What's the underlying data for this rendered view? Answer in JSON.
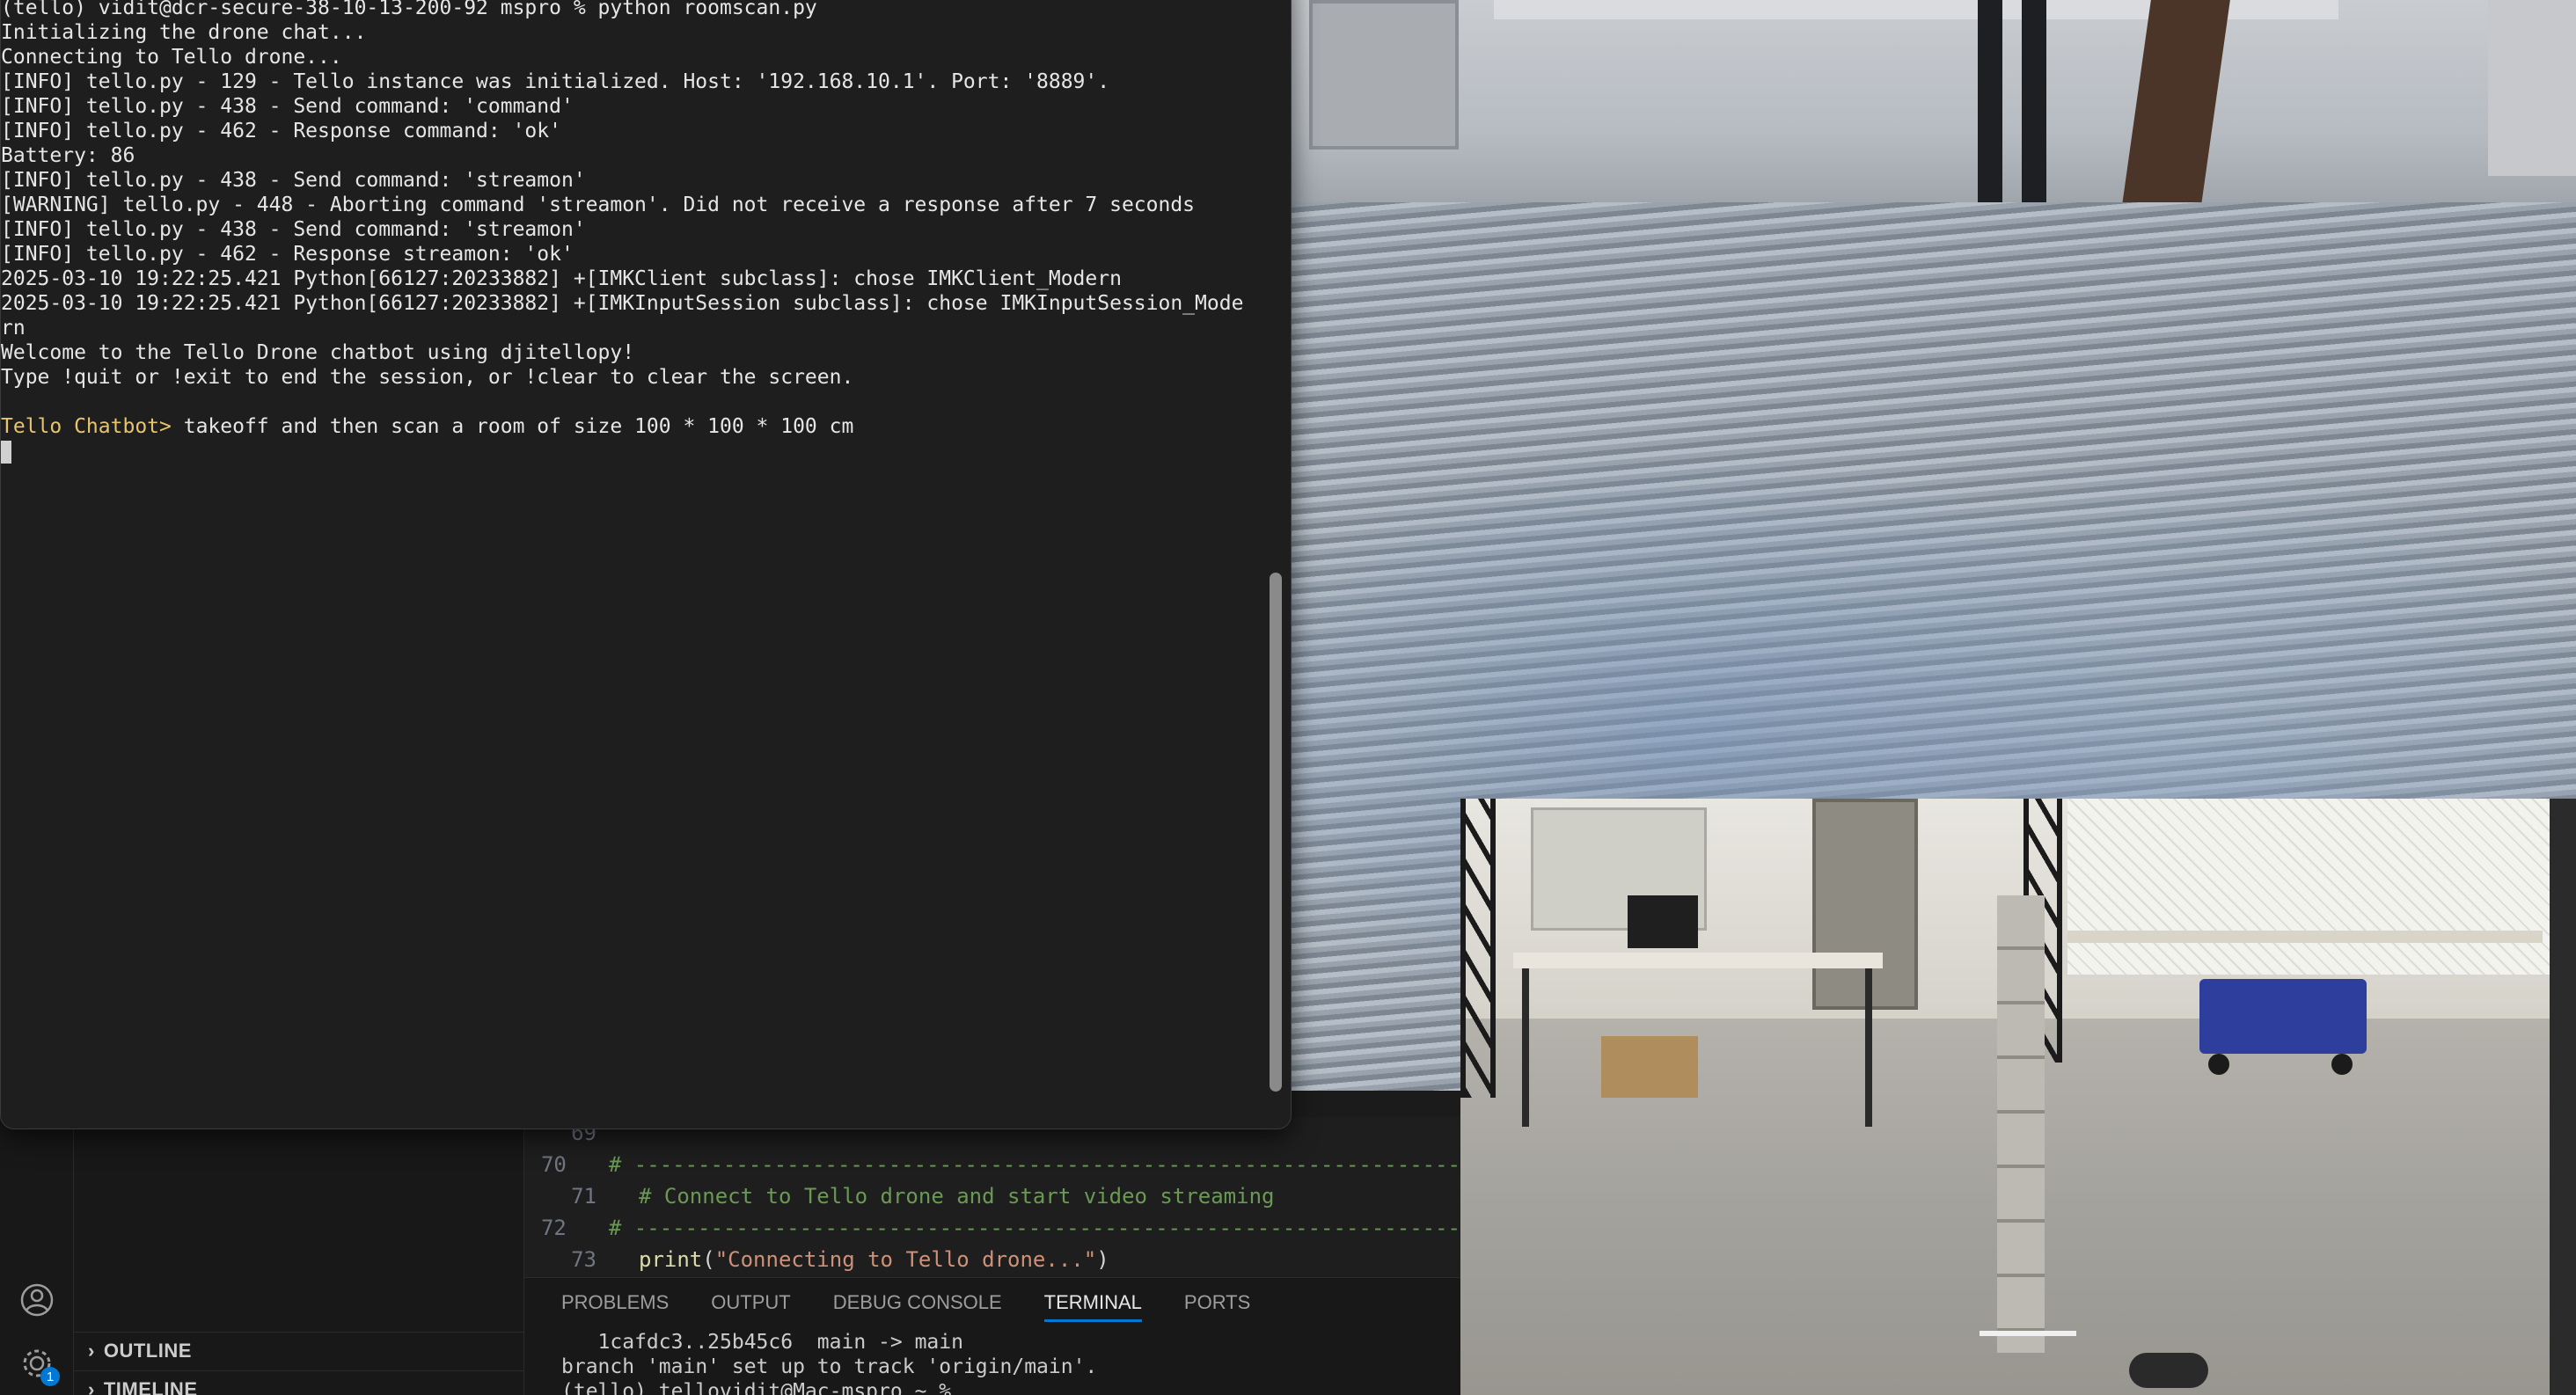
{
  "terminal": {
    "lines": [
      {
        "text": "(tello) vidit@dcr-secure-38-10-13-200-92 mspro % python roomscan.py",
        "kind": "plain"
      },
      {
        "text": "Initializing the drone chat...",
        "kind": "plain"
      },
      {
        "text": "Connecting to Tello drone...",
        "kind": "plain"
      },
      {
        "text": "[INFO] tello.py - 129 - Tello instance was initialized. Host: '192.168.10.1'. Port: '8889'.",
        "kind": "plain"
      },
      {
        "text": "[INFO] tello.py - 438 - Send command: 'command'",
        "kind": "plain"
      },
      {
        "text": "[INFO] tello.py - 462 - Response command: 'ok'",
        "kind": "plain"
      },
      {
        "text": "Battery: 86",
        "kind": "plain"
      },
      {
        "text": "[INFO] tello.py - 438 - Send command: 'streamon'",
        "kind": "plain"
      },
      {
        "text": "[WARNING] tello.py - 448 - Aborting command 'streamon'. Did not receive a response after 7 seconds",
        "kind": "plain"
      },
      {
        "text": "[INFO] tello.py - 438 - Send command: 'streamon'",
        "kind": "plain"
      },
      {
        "text": "[INFO] tello.py - 462 - Response streamon: 'ok'",
        "kind": "plain"
      },
      {
        "text": "2025-03-10 19:22:25.421 Python[66127:20233882] +[IMKClient subclass]: chose IMKClient_Modern",
        "kind": "plain"
      },
      {
        "text": "2025-03-10 19:22:25.421 Python[66127:20233882] +[IMKInputSession subclass]: chose IMKInputSession_Mode",
        "kind": "plain"
      },
      {
        "text": "rn",
        "kind": "plain"
      },
      {
        "text": "Welcome to the Tello Drone chatbot using djitellopy!",
        "kind": "plain"
      },
      {
        "text": "Type !quit or !exit to end the session, or !clear to clear the screen.",
        "kind": "plain"
      },
      {
        "text": "",
        "kind": "plain"
      }
    ],
    "prompt_label": "Tello Chatbot>",
    "prompt_input": " takeoff and then scan a room of size 100 * 100 * 100 cm"
  },
  "editor": {
    "lines": [
      {
        "num": "69",
        "text": ""
      },
      {
        "num": "70",
        "text": "# -----------------------------------------------------------------"
      },
      {
        "num": "71",
        "text": "# Connect to Tello drone and start video streaming"
      },
      {
        "num": "72",
        "text": "# -----------------------------------------------------------------"
      },
      {
        "num": "73",
        "fn": "print",
        "open": "(",
        "str": "\"Connecting to Tello drone...\"",
        "close": ")"
      }
    ]
  },
  "sidebar": {
    "sections": [
      "OUTLINE",
      "TIMELINE"
    ]
  },
  "activity": {
    "badge": "1"
  },
  "panel": {
    "tabs": [
      "PROBLEMS",
      "OUTPUT",
      "DEBUG CONSOLE",
      "TERMINAL",
      "PORTS"
    ],
    "active_tab": "TERMINAL",
    "lines": [
      "   1cafdc3..25b45c6  main -> main",
      "branch 'main' set up to track 'origin/main'.",
      "(tello) tellovidit@Mac-mspro ~ % "
    ]
  },
  "colors": {
    "prompt": "#e8c46c",
    "comment": "#6a9955",
    "function": "#dcdcaa",
    "string": "#ce9178",
    "tab_underline": "#0078d4"
  },
  "icons": {
    "account": "account-icon",
    "manage": "gear-icon",
    "chevron": "chevron-right-icon"
  }
}
